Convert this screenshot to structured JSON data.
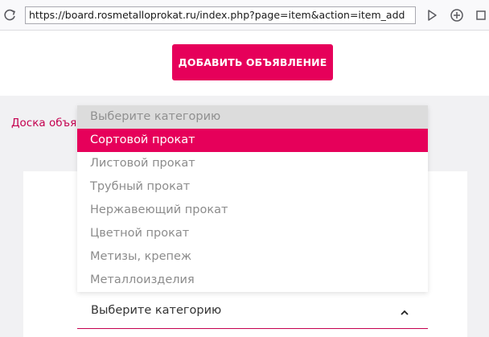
{
  "browser": {
    "url": "https://board.rosmetalloprokat.ru/index.php?page=item&action=item_add",
    "icons": [
      "reload-icon",
      "go-icon",
      "add-icon",
      "extensions-icon"
    ]
  },
  "header": {
    "add_button_label": "ДОБАВИТЬ ОБЪЯВЛЕНИЕ",
    "accent_color": "#e6005a"
  },
  "breadcrumb": {
    "text": "Доска объяв"
  },
  "category_select": {
    "value": "Выберите категорию",
    "expanded": true,
    "options": [
      {
        "label": "Выберите категорию",
        "state": "placeholder"
      },
      {
        "label": "Сортовой прокат",
        "state": "highlighted"
      },
      {
        "label": "Листовой прокат",
        "state": "normal"
      },
      {
        "label": "Трубный прокат",
        "state": "normal"
      },
      {
        "label": "Нержавеющий прокат",
        "state": "normal"
      },
      {
        "label": "Цветной прокат",
        "state": "normal"
      },
      {
        "label": "Метизы, крепеж",
        "state": "normal"
      },
      {
        "label": "Металлоизделия",
        "state": "normal"
      }
    ]
  }
}
